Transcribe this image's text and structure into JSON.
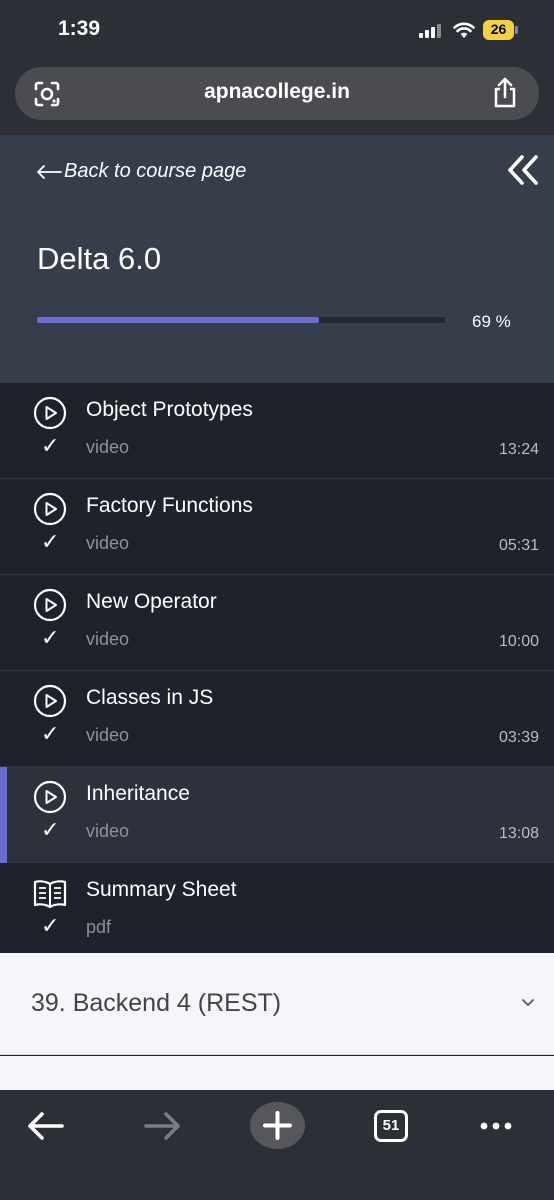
{
  "status_bar": {
    "time": "1:39",
    "battery": "26",
    "icons": [
      "signal-icon",
      "wifi-icon",
      "battery-icon"
    ]
  },
  "browser": {
    "url": "apnacollege.in",
    "icons": [
      "lens-icon",
      "share-icon"
    ]
  },
  "course": {
    "back_label": "Back to course page",
    "title": "Delta 6.0",
    "progress_label": "69 %",
    "progress_fraction": 0.69,
    "accent": "#6a6ccf"
  },
  "lessons": [
    {
      "title": "Object Prototypes",
      "kind": "video",
      "duration": "13:24",
      "icon": "play-icon",
      "check": "✓"
    },
    {
      "title": "Factory Functions",
      "kind": "video",
      "duration": "05:31",
      "icon": "play-icon",
      "check": "✓"
    },
    {
      "title": "New Operator",
      "kind": "video",
      "duration": "10:00",
      "icon": "play-icon",
      "check": "✓"
    },
    {
      "title": "Classes in JS",
      "kind": "video",
      "duration": "03:39",
      "icon": "play-icon",
      "check": "✓"
    },
    {
      "title": "Inheritance",
      "kind": "video",
      "duration": "13:08",
      "icon": "play-icon",
      "check": "✓",
      "active": true
    },
    {
      "title": "Summary Sheet",
      "kind": "pdf",
      "duration": "",
      "icon": "book-icon",
      "check": "✓"
    }
  ],
  "section": {
    "title": "39. Backend 4 (REST)"
  },
  "toolbar": {
    "tabs_count": "51",
    "icons": [
      "back-arrow-icon",
      "forward-arrow-icon",
      "plus-icon",
      "tabs-icon",
      "more-icon"
    ]
  }
}
